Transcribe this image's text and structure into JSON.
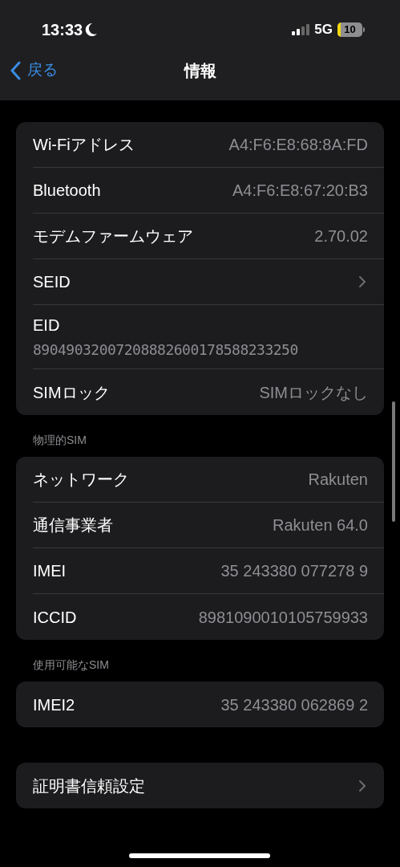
{
  "status_bar": {
    "time": "13:33",
    "network": "5G",
    "battery": "10"
  },
  "nav": {
    "back": "戻る",
    "title": "情報"
  },
  "sections": [
    {
      "rows": [
        {
          "kind": "value",
          "label": "Wi-Fiアドレス",
          "value": "A4:F6:E8:68:8A:FD"
        },
        {
          "kind": "value",
          "label": "Bluetooth",
          "value": "A4:F6:E8:67:20:B3"
        },
        {
          "kind": "value",
          "label": "モデムファームウェア",
          "value": "2.70.02"
        },
        {
          "kind": "chevron",
          "label": "SEID"
        },
        {
          "kind": "stacked",
          "label": "EID",
          "value": "89049032007208882600178588233250"
        },
        {
          "kind": "value",
          "label": "SIMロック",
          "value": "SIMロックなし"
        }
      ]
    },
    {
      "header": "物理的SIM",
      "rows": [
        {
          "kind": "value",
          "label": "ネットワーク",
          "value": "Rakuten"
        },
        {
          "kind": "value",
          "label": "通信事業者",
          "value": "Rakuten 64.0"
        },
        {
          "kind": "value",
          "label": "IMEI",
          "value": "35 243380 077278 9"
        },
        {
          "kind": "value",
          "label": "ICCID",
          "value": "8981090010105759933"
        }
      ]
    },
    {
      "header": "使用可能なSIM",
      "rows": [
        {
          "kind": "value",
          "label": "IMEI2",
          "value": "35 243380 062869 2"
        }
      ]
    },
    {
      "rows": [
        {
          "kind": "chevron",
          "label": "証明書信頼設定"
        }
      ]
    }
  ]
}
